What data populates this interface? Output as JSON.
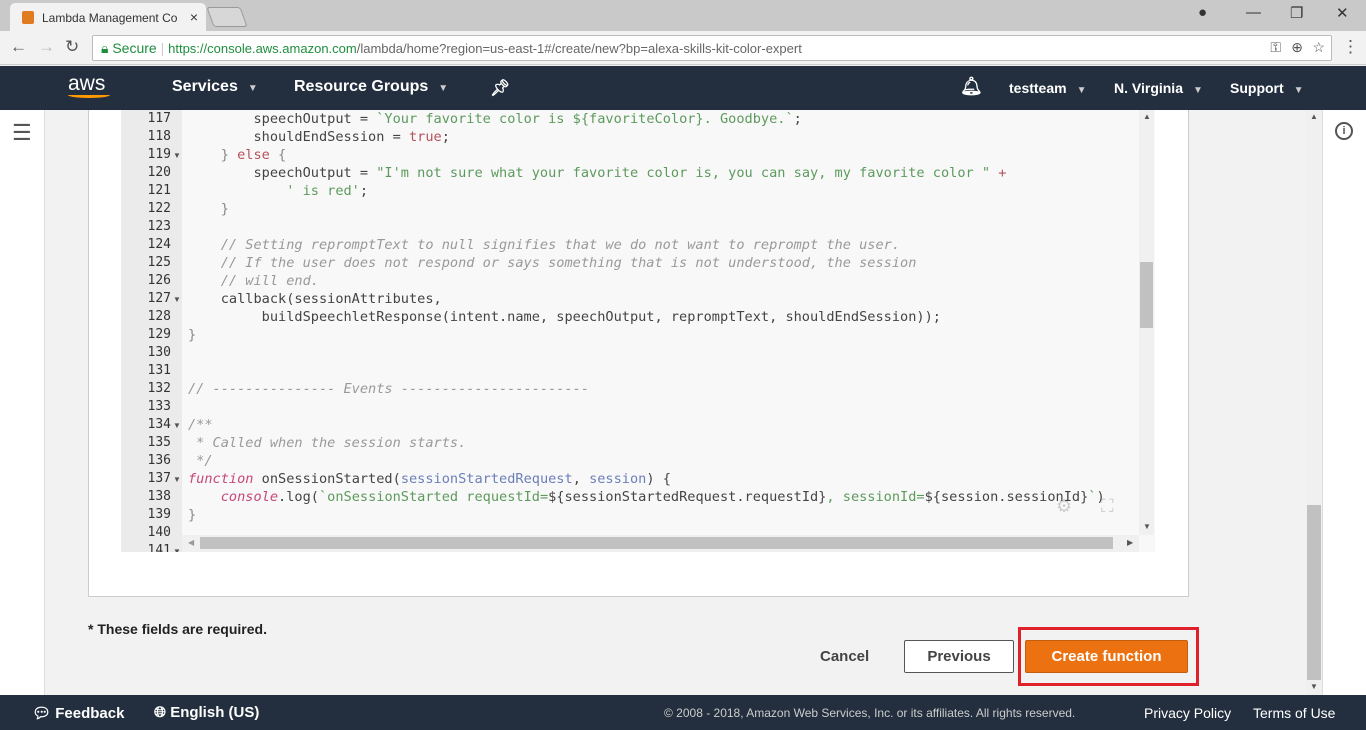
{
  "browser": {
    "tab_title": "Lambda Management Co",
    "url_secure": "Secure",
    "url_host": "https://console.aws.amazon.com",
    "url_path": "/lambda/home?region=us-east-1#/create/new?bp=alexa-skills-kit-color-expert"
  },
  "nav": {
    "logo": "aws",
    "services": "Services",
    "resource_groups": "Resource Groups",
    "user": "testteam",
    "region": "N. Virginia",
    "support": "Support"
  },
  "code": {
    "lines": [
      {
        "n": "117",
        "f": false,
        "t": [
          [
            "",
            "        speechOutput = "
          ],
          [
            "s",
            "`Your favorite color is ${favoriteColor}. Goodbye.`"
          ],
          [
            "",
            ";"
          ]
        ]
      },
      {
        "n": "118",
        "f": false,
        "t": [
          [
            "",
            "        shouldEndSession = "
          ],
          [
            "b",
            "true"
          ],
          [
            "",
            ";"
          ]
        ]
      },
      {
        "n": "119",
        "f": true,
        "t": [
          [
            "o",
            "    } "
          ],
          [
            "b",
            "else"
          ],
          [
            "o",
            " {"
          ]
        ]
      },
      {
        "n": "120",
        "f": false,
        "t": [
          [
            "",
            "        speechOutput = "
          ],
          [
            "s",
            "\"I'm not sure what your favorite color is, you can say, my favorite color \""
          ],
          [
            "b",
            " +"
          ]
        ]
      },
      {
        "n": "121",
        "f": false,
        "t": [
          [
            "s",
            "            ' is red'"
          ],
          [
            "",
            ";"
          ]
        ]
      },
      {
        "n": "122",
        "f": false,
        "t": [
          [
            "o",
            "    }"
          ]
        ]
      },
      {
        "n": "123",
        "f": false,
        "t": []
      },
      {
        "n": "124",
        "f": false,
        "t": [
          [
            "c",
            "    // Setting repromptText to null signifies that we do not want to reprompt the user."
          ]
        ]
      },
      {
        "n": "125",
        "f": false,
        "t": [
          [
            "c",
            "    // If the user does not respond or says something that is not understood, the session"
          ]
        ]
      },
      {
        "n": "126",
        "f": false,
        "t": [
          [
            "c",
            "    // will end."
          ]
        ]
      },
      {
        "n": "127",
        "f": true,
        "t": [
          [
            "",
            "    callback(sessionAttributes,"
          ]
        ]
      },
      {
        "n": "128",
        "f": false,
        "t": [
          [
            "",
            "         buildSpeechletResponse(intent.name, speechOutput, repromptText, shouldEndSession));"
          ]
        ]
      },
      {
        "n": "129",
        "f": false,
        "t": [
          [
            "o",
            "}"
          ]
        ]
      },
      {
        "n": "130",
        "f": false,
        "t": []
      },
      {
        "n": "131",
        "f": false,
        "t": []
      },
      {
        "n": "132",
        "f": false,
        "t": [
          [
            "c",
            "// --------------- Events -----------------------"
          ]
        ]
      },
      {
        "n": "133",
        "f": false,
        "t": []
      },
      {
        "n": "134",
        "f": true,
        "t": [
          [
            "c",
            "/**"
          ]
        ]
      },
      {
        "n": "135",
        "f": false,
        "t": [
          [
            "c",
            " * Called when the session starts."
          ]
        ]
      },
      {
        "n": "136",
        "f": false,
        "t": [
          [
            "c",
            " */"
          ]
        ]
      },
      {
        "n": "137",
        "f": true,
        "t": [
          [
            "k",
            "function"
          ],
          [
            "",
            " onSessionStarted("
          ],
          [
            "p",
            "sessionStartedRequest"
          ],
          [
            "",
            ", "
          ],
          [
            "p",
            "session"
          ],
          [
            "",
            ") {"
          ]
        ]
      },
      {
        "n": "138",
        "f": false,
        "t": [
          [
            "",
            "    "
          ],
          [
            "k",
            "console"
          ],
          [
            "",
            ".log("
          ],
          [
            "s",
            "`onSessionStarted requestId="
          ],
          [
            "",
            "${sessionStartedRequest.requestId}"
          ],
          [
            "s",
            ", sessionId="
          ],
          [
            "",
            "${session.sessionId}"
          ],
          [
            "s",
            "`"
          ],
          [
            "",
            ")"
          ]
        ]
      },
      {
        "n": "139",
        "f": false,
        "t": [
          [
            "o",
            "}"
          ]
        ]
      },
      {
        "n": "140",
        "f": false,
        "t": []
      },
      {
        "n": "141",
        "f": true,
        "t": []
      }
    ]
  },
  "form": {
    "required_note": "* These fields are required.",
    "cancel": "Cancel",
    "previous": "Previous",
    "create": "Create function"
  },
  "footer": {
    "feedback": "Feedback",
    "language": "English (US)",
    "copyright": "© 2008 - 2018, Amazon Web Services, Inc. or its affiliates. All rights reserved.",
    "privacy": "Privacy Policy",
    "terms": "Terms of Use"
  },
  "colors": {
    "nav_bg": "#232f3e",
    "primary": "#ec7211",
    "highlight": "#e0202a"
  }
}
